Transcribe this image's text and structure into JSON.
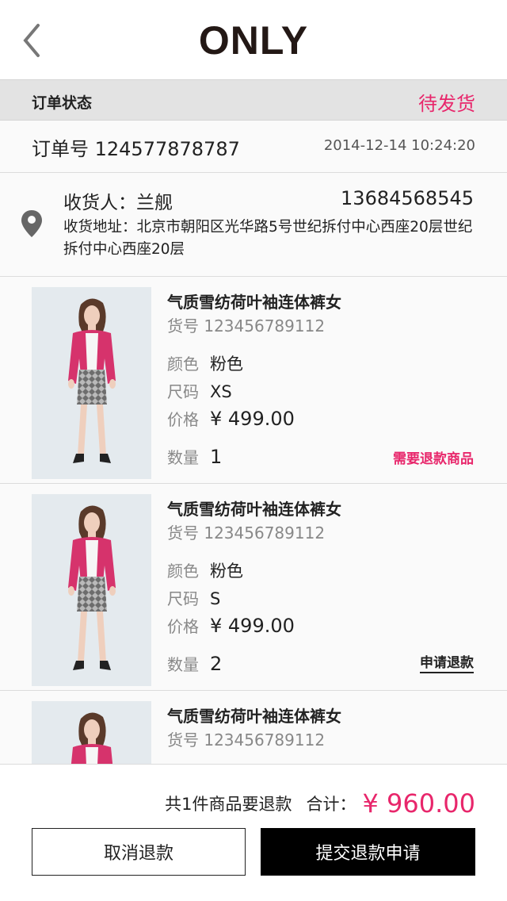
{
  "header": {
    "brand": "ONLY",
    "back_icon": "chevron-left-icon"
  },
  "order": {
    "status_label": "订单状态",
    "status_value": "待发货",
    "order_number": "订单号 124577878787",
    "order_time": "2014-12-14 10:24:20"
  },
  "shipping": {
    "location_icon": "map-pin-icon",
    "receiver": "收货人：兰舰",
    "phone": "13684568545",
    "address": "收货地址：北京市朝阳区光华路5号世纪拆付中心西座20层世纪拆付中心西座20层"
  },
  "labels": {
    "color": "颜色",
    "size": "尺码",
    "price": "价格",
    "quantity": "数量"
  },
  "items": [
    {
      "name": "气质雪纺荷叶袖连体裤女",
      "sku": "货号 123456789112",
      "color": "粉色",
      "size": "XS",
      "price": "¥ 499.00",
      "quantity": "1",
      "action": "需要退款商品"
    },
    {
      "name": "气质雪纺荷叶袖连体裤女",
      "sku": "货号 123456789112",
      "color": "粉色",
      "size": "S",
      "price": "¥ 499.00",
      "quantity": "2",
      "action": "申请退款"
    },
    {
      "name": "气质雪纺荷叶袖连体裤女",
      "sku": "货号 123456789112"
    }
  ],
  "footer": {
    "summary_text": "共1件商品要退款",
    "total_label": "合计：",
    "total_value": "¥ 960.00",
    "cancel_label": "取消退款",
    "submit_label": "提交退款申请"
  },
  "colors": {
    "accent": "#e8266b",
    "primary_button": "#000000",
    "status_bar": "#e3e3e3"
  }
}
